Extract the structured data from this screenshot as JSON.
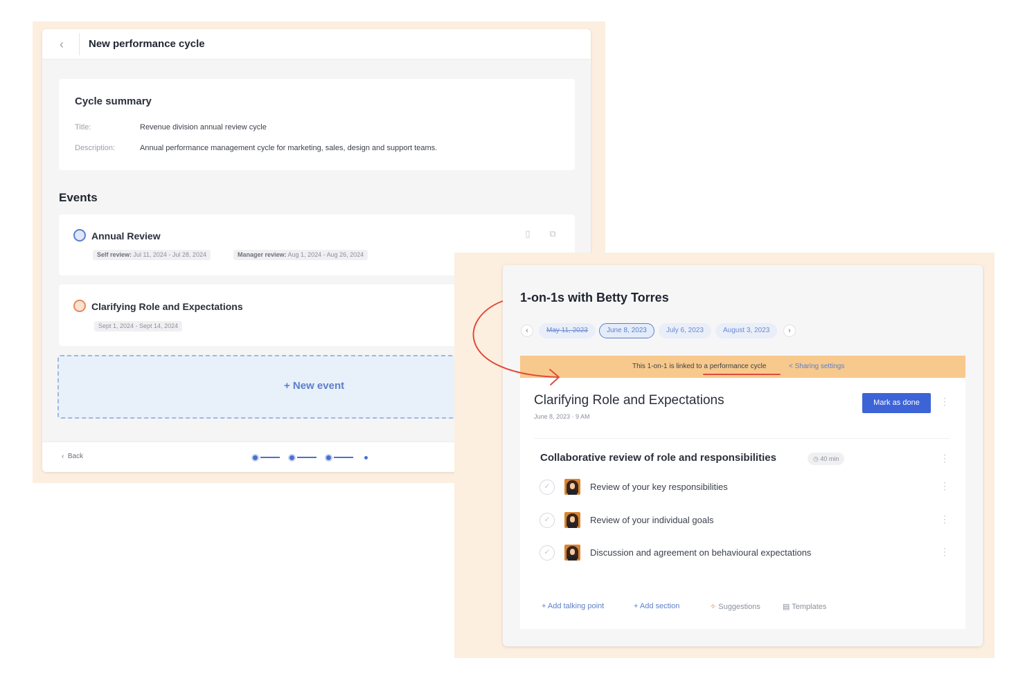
{
  "left_window": {
    "title": "New performance cycle",
    "summary": {
      "heading": "Cycle summary",
      "title_label": "Title:",
      "title_value": "Revenue division annual review cycle",
      "description_label": "Description:",
      "description_value": "Annual performance management cycle for marketing, sales, design and support teams."
    },
    "events_heading": "Events",
    "events": [
      {
        "title": "Annual Review",
        "icon": "calendar-icon",
        "pills": [
          {
            "label": "Self review:",
            "value": "Jul 11, 2024 - Jul 28, 2024"
          },
          {
            "label": "Manager review:",
            "value": "Aug 1, 2024 - Aug 26, 2024"
          }
        ]
      },
      {
        "title": "Clarifying Role and Expectations",
        "icon": "one-on-one-icon",
        "pills": [
          {
            "label": "",
            "value": "Sept 1, 2024 - Sept 14, 2024"
          }
        ]
      }
    ],
    "new_event_label": "+ New event",
    "footer": {
      "back_label": "Back"
    }
  },
  "right_window": {
    "title": "1-on-1s with Betty Torres",
    "dates": [
      "May 11, 2023",
      "June 8, 2023",
      "July 6, 2023",
      "August 3, 2023"
    ],
    "active_date_index": 1,
    "banner": {
      "text": "This 1-on-1 is linked to a performance cycle",
      "link": "< Sharing settings"
    },
    "meeting": {
      "title": "Clarifying Role and Expectations",
      "datetime": "June 8, 2023 · 9 AM",
      "mark_done_label": "Mark as done"
    },
    "section": {
      "title": "Collaborative review of role and responsibilities",
      "duration": "◷ 40 min",
      "talking_points": [
        "Review of your key responsibilities",
        "Review of your individual goals",
        "Discussion and agreement on behavioural expectations"
      ]
    },
    "footer_actions": {
      "add_talking_point": "+ Add talking point",
      "add_section": "+ Add section",
      "suggestions": "Suggestions",
      "templates": "Templates"
    }
  },
  "colors": {
    "accent": "#3d64d6",
    "banner": "#f8c98c",
    "background_frame": "#fcefe0",
    "arrow": "#e04b3a"
  }
}
